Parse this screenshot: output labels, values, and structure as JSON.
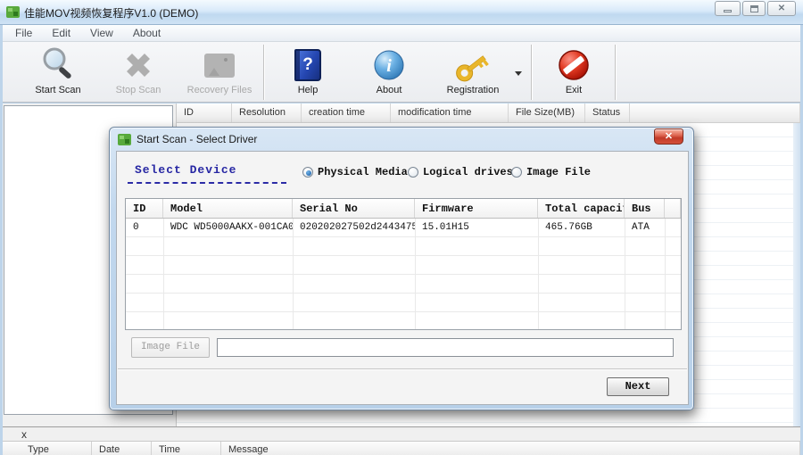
{
  "window": {
    "title": "佳能MOV视频恢复程序V1.0 (DEMO)",
    "controls": {
      "minimize": "minimize",
      "maximize": "maximize",
      "close": "close"
    }
  },
  "menu": {
    "items": [
      "File",
      "Edit",
      "View",
      "About"
    ]
  },
  "toolbar": {
    "buttons": [
      {
        "label": "Start Scan",
        "icon": "magnifier-icon",
        "enabled": true
      },
      {
        "label": "Stop Scan",
        "icon": "stop-x-icon",
        "enabled": false
      },
      {
        "label": "Recovery  Files",
        "icon": "camera-icon",
        "enabled": false
      },
      {
        "label": "Help",
        "icon": "book-question-icon",
        "enabled": true,
        "glyph": "?"
      },
      {
        "label": "About",
        "icon": "info-sphere-icon",
        "enabled": true,
        "glyph": "i"
      },
      {
        "label": "Registration",
        "icon": "key-icon",
        "enabled": true
      },
      {
        "label": "Exit",
        "icon": "no-entry-icon",
        "enabled": true
      }
    ]
  },
  "main_table": {
    "columns": [
      "ID",
      "Resolution",
      "creation time",
      "modification time",
      "File Size(MB)",
      "Status"
    ]
  },
  "log_panel": {
    "close_label": "x",
    "columns": [
      "Type",
      "Date",
      "Time",
      "Message"
    ]
  },
  "dialog": {
    "title": "Start Scan - Select Driver",
    "close_label": "x",
    "section_label": "Select Device",
    "radios": [
      {
        "label": "Physical Media",
        "selected": true
      },
      {
        "label": "Logical drives",
        "selected": false
      },
      {
        "label": "Image File",
        "selected": false
      }
    ],
    "device_table": {
      "columns": [
        "ID",
        "Model",
        "Serial No",
        "Firmware",
        "Total capacity",
        "Bus"
      ],
      "rows": [
        [
          "0",
          "WDC WD5000AAKX-001CA0",
          "020202027502d2443475...",
          "15.01H15",
          "465.76GB",
          "ATA"
        ]
      ]
    },
    "image_file_button": "Image File",
    "image_file_value": "",
    "next_button": "Next"
  },
  "colors": {
    "titlebar_blue": "#bfd9f0",
    "dialog_frame_blue": "#c2d8ee",
    "close_button_red": "#c23a28",
    "section_label_navy": "#2626a3",
    "key_gold": "#e9b62b",
    "exit_red": "#d92c15",
    "about_blue": "#5ba3dd",
    "help_blue": "#2547b2",
    "app_icon_green": "#58a93c"
  }
}
